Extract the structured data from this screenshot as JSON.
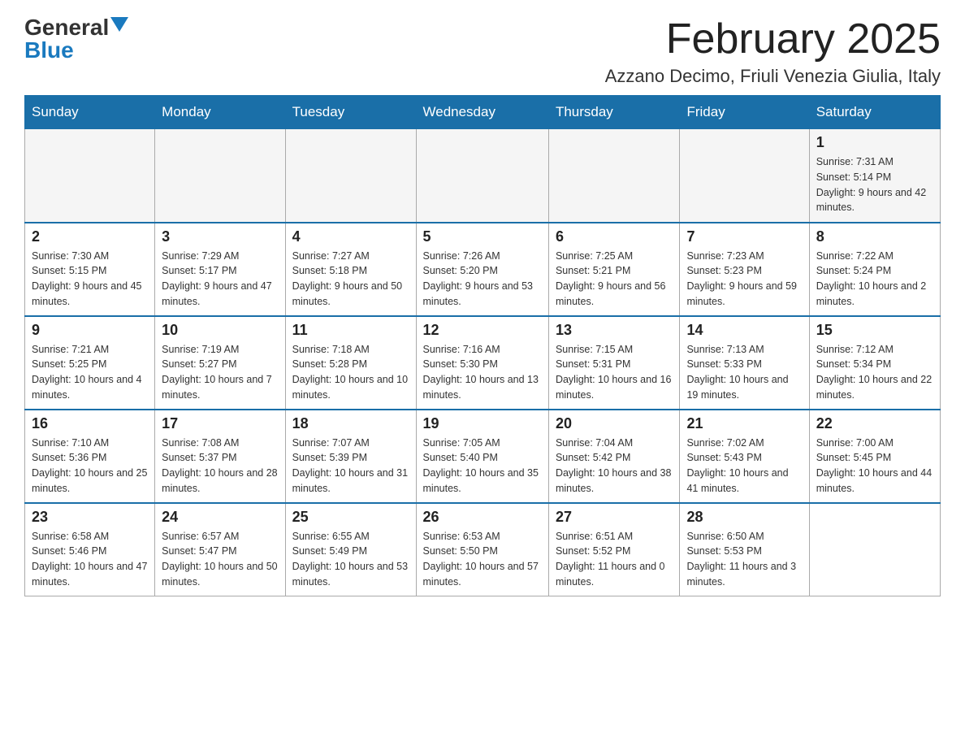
{
  "logo": {
    "general": "General",
    "blue": "Blue"
  },
  "header": {
    "month": "February 2025",
    "location": "Azzano Decimo, Friuli Venezia Giulia, Italy"
  },
  "weekdays": [
    "Sunday",
    "Monday",
    "Tuesday",
    "Wednesday",
    "Thursday",
    "Friday",
    "Saturday"
  ],
  "weeks": [
    [
      {
        "day": "",
        "sunrise": "",
        "sunset": "",
        "daylight": "",
        "empty": true
      },
      {
        "day": "",
        "sunrise": "",
        "sunset": "",
        "daylight": "",
        "empty": true
      },
      {
        "day": "",
        "sunrise": "",
        "sunset": "",
        "daylight": "",
        "empty": true
      },
      {
        "day": "",
        "sunrise": "",
        "sunset": "",
        "daylight": "",
        "empty": true
      },
      {
        "day": "",
        "sunrise": "",
        "sunset": "",
        "daylight": "",
        "empty": true
      },
      {
        "day": "",
        "sunrise": "",
        "sunset": "",
        "daylight": "",
        "empty": true
      },
      {
        "day": "1",
        "sunrise": "Sunrise: 7:31 AM",
        "sunset": "Sunset: 5:14 PM",
        "daylight": "Daylight: 9 hours and 42 minutes."
      }
    ],
    [
      {
        "day": "2",
        "sunrise": "Sunrise: 7:30 AM",
        "sunset": "Sunset: 5:15 PM",
        "daylight": "Daylight: 9 hours and 45 minutes."
      },
      {
        "day": "3",
        "sunrise": "Sunrise: 7:29 AM",
        "sunset": "Sunset: 5:17 PM",
        "daylight": "Daylight: 9 hours and 47 minutes."
      },
      {
        "day": "4",
        "sunrise": "Sunrise: 7:27 AM",
        "sunset": "Sunset: 5:18 PM",
        "daylight": "Daylight: 9 hours and 50 minutes."
      },
      {
        "day": "5",
        "sunrise": "Sunrise: 7:26 AM",
        "sunset": "Sunset: 5:20 PM",
        "daylight": "Daylight: 9 hours and 53 minutes."
      },
      {
        "day": "6",
        "sunrise": "Sunrise: 7:25 AM",
        "sunset": "Sunset: 5:21 PM",
        "daylight": "Daylight: 9 hours and 56 minutes."
      },
      {
        "day": "7",
        "sunrise": "Sunrise: 7:23 AM",
        "sunset": "Sunset: 5:23 PM",
        "daylight": "Daylight: 9 hours and 59 minutes."
      },
      {
        "day": "8",
        "sunrise": "Sunrise: 7:22 AM",
        "sunset": "Sunset: 5:24 PM",
        "daylight": "Daylight: 10 hours and 2 minutes."
      }
    ],
    [
      {
        "day": "9",
        "sunrise": "Sunrise: 7:21 AM",
        "sunset": "Sunset: 5:25 PM",
        "daylight": "Daylight: 10 hours and 4 minutes."
      },
      {
        "day": "10",
        "sunrise": "Sunrise: 7:19 AM",
        "sunset": "Sunset: 5:27 PM",
        "daylight": "Daylight: 10 hours and 7 minutes."
      },
      {
        "day": "11",
        "sunrise": "Sunrise: 7:18 AM",
        "sunset": "Sunset: 5:28 PM",
        "daylight": "Daylight: 10 hours and 10 minutes."
      },
      {
        "day": "12",
        "sunrise": "Sunrise: 7:16 AM",
        "sunset": "Sunset: 5:30 PM",
        "daylight": "Daylight: 10 hours and 13 minutes."
      },
      {
        "day": "13",
        "sunrise": "Sunrise: 7:15 AM",
        "sunset": "Sunset: 5:31 PM",
        "daylight": "Daylight: 10 hours and 16 minutes."
      },
      {
        "day": "14",
        "sunrise": "Sunrise: 7:13 AM",
        "sunset": "Sunset: 5:33 PM",
        "daylight": "Daylight: 10 hours and 19 minutes."
      },
      {
        "day": "15",
        "sunrise": "Sunrise: 7:12 AM",
        "sunset": "Sunset: 5:34 PM",
        "daylight": "Daylight: 10 hours and 22 minutes."
      }
    ],
    [
      {
        "day": "16",
        "sunrise": "Sunrise: 7:10 AM",
        "sunset": "Sunset: 5:36 PM",
        "daylight": "Daylight: 10 hours and 25 minutes."
      },
      {
        "day": "17",
        "sunrise": "Sunrise: 7:08 AM",
        "sunset": "Sunset: 5:37 PM",
        "daylight": "Daylight: 10 hours and 28 minutes."
      },
      {
        "day": "18",
        "sunrise": "Sunrise: 7:07 AM",
        "sunset": "Sunset: 5:39 PM",
        "daylight": "Daylight: 10 hours and 31 minutes."
      },
      {
        "day": "19",
        "sunrise": "Sunrise: 7:05 AM",
        "sunset": "Sunset: 5:40 PM",
        "daylight": "Daylight: 10 hours and 35 minutes."
      },
      {
        "day": "20",
        "sunrise": "Sunrise: 7:04 AM",
        "sunset": "Sunset: 5:42 PM",
        "daylight": "Daylight: 10 hours and 38 minutes."
      },
      {
        "day": "21",
        "sunrise": "Sunrise: 7:02 AM",
        "sunset": "Sunset: 5:43 PM",
        "daylight": "Daylight: 10 hours and 41 minutes."
      },
      {
        "day": "22",
        "sunrise": "Sunrise: 7:00 AM",
        "sunset": "Sunset: 5:45 PM",
        "daylight": "Daylight: 10 hours and 44 minutes."
      }
    ],
    [
      {
        "day": "23",
        "sunrise": "Sunrise: 6:58 AM",
        "sunset": "Sunset: 5:46 PM",
        "daylight": "Daylight: 10 hours and 47 minutes."
      },
      {
        "day": "24",
        "sunrise": "Sunrise: 6:57 AM",
        "sunset": "Sunset: 5:47 PM",
        "daylight": "Daylight: 10 hours and 50 minutes."
      },
      {
        "day": "25",
        "sunrise": "Sunrise: 6:55 AM",
        "sunset": "Sunset: 5:49 PM",
        "daylight": "Daylight: 10 hours and 53 minutes."
      },
      {
        "day": "26",
        "sunrise": "Sunrise: 6:53 AM",
        "sunset": "Sunset: 5:50 PM",
        "daylight": "Daylight: 10 hours and 57 minutes."
      },
      {
        "day": "27",
        "sunrise": "Sunrise: 6:51 AM",
        "sunset": "Sunset: 5:52 PM",
        "daylight": "Daylight: 11 hours and 0 minutes."
      },
      {
        "day": "28",
        "sunrise": "Sunrise: 6:50 AM",
        "sunset": "Sunset: 5:53 PM",
        "daylight": "Daylight: 11 hours and 3 minutes."
      },
      {
        "day": "",
        "sunrise": "",
        "sunset": "",
        "daylight": "",
        "empty": true
      }
    ]
  ]
}
